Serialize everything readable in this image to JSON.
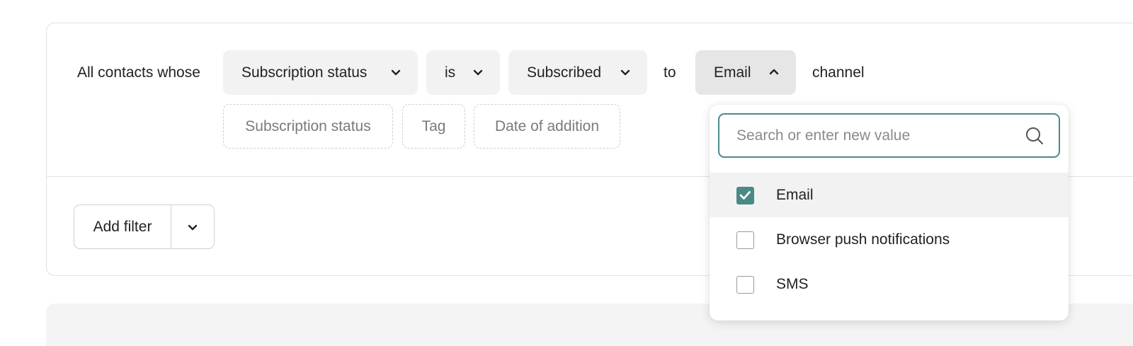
{
  "filter": {
    "lead_text": "All contacts whose",
    "field_select": "Subscription status",
    "operator_select": "is",
    "value_select": "Subscribed",
    "to_text": "to",
    "channel_select": "Email",
    "channel_text": "channel"
  },
  "quick_fields": [
    "Subscription status",
    "Tag",
    "Date of addition"
  ],
  "add_filter": {
    "label": "Add filter"
  },
  "dropdown": {
    "search_placeholder": "Search or enter new value",
    "options": [
      {
        "label": "Email",
        "checked": true
      },
      {
        "label": "Browser push notifications",
        "checked": false
      },
      {
        "label": "SMS",
        "checked": false
      }
    ]
  },
  "colors": {
    "accent": "#4a8a86",
    "pill_bg": "#f2f2f2",
    "border": "#e2e2e2"
  },
  "icons": [
    "chevron-down-icon",
    "chevron-up-icon",
    "search-icon",
    "check-icon"
  ]
}
